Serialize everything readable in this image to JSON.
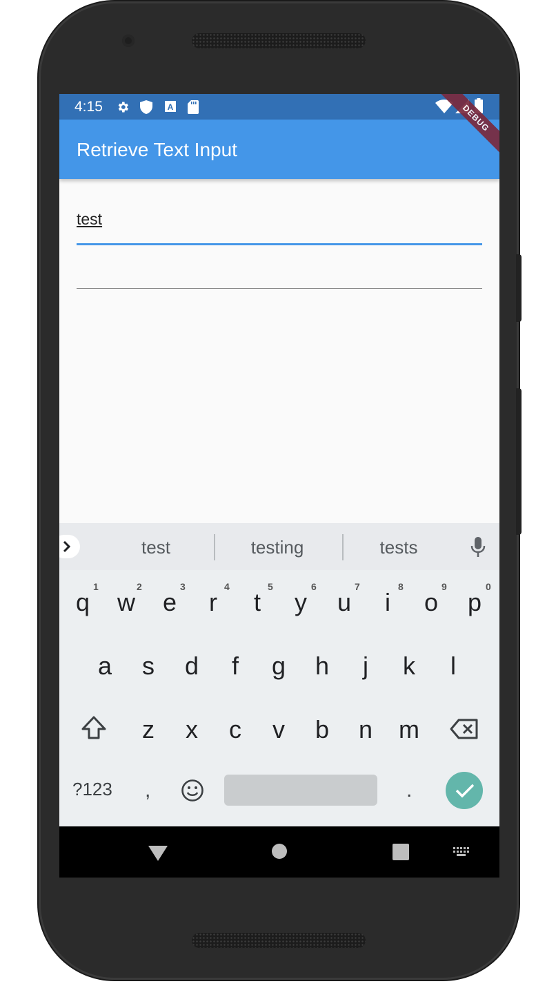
{
  "status_bar": {
    "time": "4:15",
    "debug_banner": "DEBUG",
    "icons": [
      "settings-icon",
      "shield-icon",
      "font-a-icon",
      "sd-card-icon",
      "wifi-icon",
      "signal-icon",
      "battery-icon"
    ]
  },
  "app_bar": {
    "title": "Retrieve Text Input",
    "color": "#4496e8"
  },
  "form": {
    "field1_value": "test",
    "field2_value": ""
  },
  "keyboard": {
    "suggestions": [
      "test",
      "testing",
      "tests"
    ],
    "row1": [
      "q",
      "w",
      "e",
      "r",
      "t",
      "y",
      "u",
      "i",
      "o",
      "p"
    ],
    "row1_hints": [
      "1",
      "2",
      "3",
      "4",
      "5",
      "6",
      "7",
      "8",
      "9",
      "0"
    ],
    "row2": [
      "a",
      "s",
      "d",
      "f",
      "g",
      "h",
      "j",
      "k",
      "l"
    ],
    "row3": [
      "z",
      "x",
      "c",
      "v",
      "b",
      "n",
      "m"
    ],
    "symbols_key": "?123",
    "comma_key": ",",
    "period_key": ".",
    "accent": "#63b6ab"
  },
  "nav_bar": {
    "icons": [
      "back-icon",
      "home-icon",
      "recents-icon",
      "keyboard-switch-icon"
    ]
  }
}
